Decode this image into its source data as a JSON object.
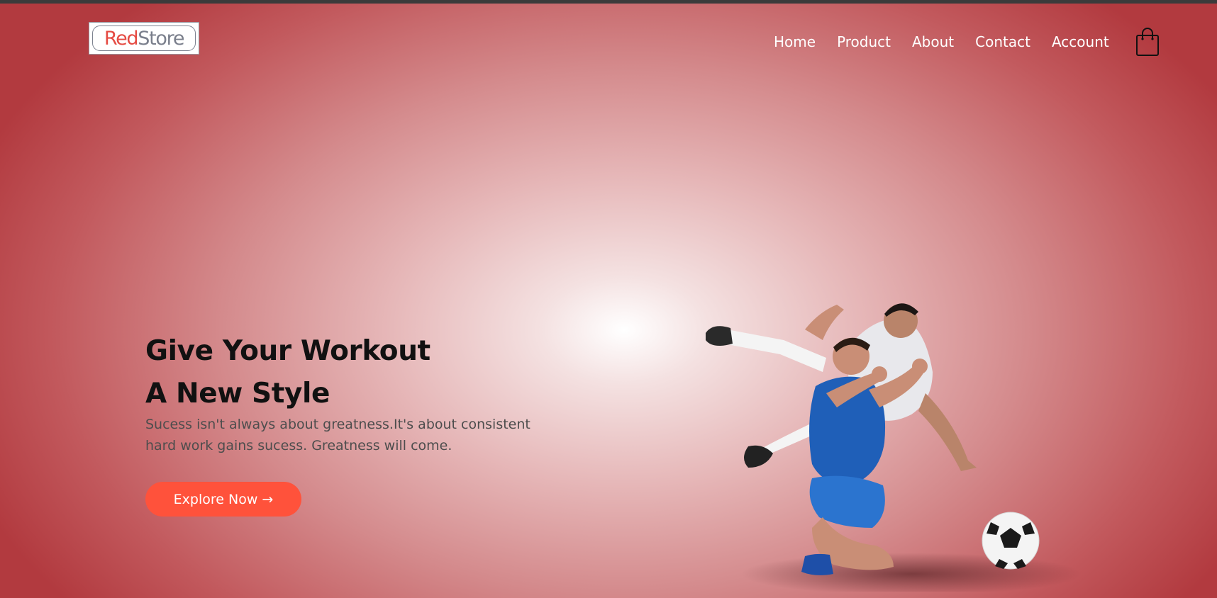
{
  "brand": {
    "part1": "Red",
    "part2": "Store"
  },
  "nav": {
    "items": [
      {
        "label": "Home"
      },
      {
        "label": "Product"
      },
      {
        "label": "About"
      },
      {
        "label": "Contact"
      },
      {
        "label": "Account"
      }
    ],
    "cart_icon": "shopping-bag-icon"
  },
  "hero": {
    "title_line1": "Give Your Workout",
    "title_line2": "A New Style",
    "text_line1": "Sucess isn't always about greatness.It's about consistent",
    "text_line2": "hard work gains sucess. Greatness will come.",
    "cta_label": "Explore Now →"
  },
  "colors": {
    "accent": "#ff523b",
    "brand_red": "#e54b43",
    "background_edge": "#b23a3f",
    "topbar": "#3b3b3b"
  }
}
